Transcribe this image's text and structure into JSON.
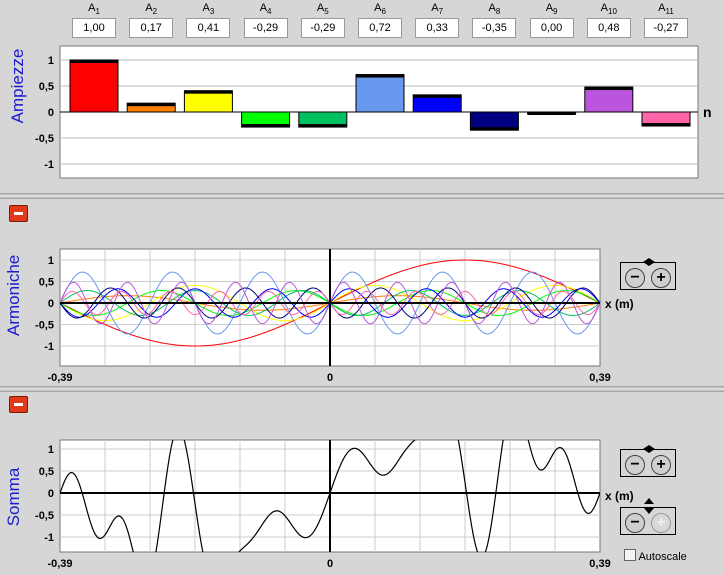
{
  "amplitudes": {
    "items": [
      {
        "label": "A",
        "sub": "1",
        "value": "1,00",
        "v": 1.0,
        "color": "#ff0000"
      },
      {
        "label": "A",
        "sub": "2",
        "value": "0,17",
        "v": 0.17,
        "color": "#ff8000"
      },
      {
        "label": "A",
        "sub": "3",
        "value": "0,41",
        "v": 0.41,
        "color": "#ffff00"
      },
      {
        "label": "A",
        "sub": "4",
        "value": "-0,29",
        "v": -0.29,
        "color": "#00ff00"
      },
      {
        "label": "A",
        "sub": "5",
        "value": "-0,29",
        "v": -0.29,
        "color": "#00c060"
      },
      {
        "label": "A",
        "sub": "6",
        "value": "0,72",
        "v": 0.72,
        "color": "#6699ee"
      },
      {
        "label": "A",
        "sub": "7",
        "value": "0,33",
        "v": 0.33,
        "color": "#0000ff"
      },
      {
        "label": "A",
        "sub": "8",
        "value": "-0,35",
        "v": -0.35,
        "color": "#000080"
      },
      {
        "label": "A",
        "sub": "9",
        "value": "0,00",
        "v": 0.0,
        "color": "#444444"
      },
      {
        "label": "A",
        "sub": "10",
        "value": "0,48",
        "v": 0.48,
        "color": "#bb55dd"
      },
      {
        "label": "A",
        "sub": "11",
        "value": "-0,27",
        "v": -0.27,
        "color": "#ff66aa"
      }
    ],
    "ylabel": "Ampiezze",
    "n_label": "n",
    "yticks": [
      "1",
      "0,5",
      "0",
      "-0,5",
      "-1"
    ]
  },
  "harmonics": {
    "ylabel": "Armoniche",
    "x_axis_label": "x (m)",
    "x_ticks": [
      "-0,39",
      "0",
      "0,39"
    ],
    "yticks": [
      "1",
      "0,5",
      "0",
      "-0,5",
      "-1"
    ]
  },
  "sum": {
    "ylabel": "Somma",
    "x_axis_label": "x (m)",
    "x_ticks": [
      "-0,39",
      "0",
      "0,39"
    ],
    "yticks": [
      "1",
      "0,5",
      "0",
      "-0,5",
      "-1"
    ],
    "autoscale_label": "Autoscale"
  },
  "chart_data": [
    {
      "type": "bar",
      "categories": [
        "A1",
        "A2",
        "A3",
        "A4",
        "A5",
        "A6",
        "A7",
        "A8",
        "A9",
        "A10",
        "A11"
      ],
      "values": [
        1.0,
        0.17,
        0.41,
        -0.29,
        -0.29,
        0.72,
        0.33,
        -0.35,
        0.0,
        0.48,
        -0.27
      ],
      "ylabel": "Ampiezze",
      "xlabel": "n",
      "ylim": [
        -1.3,
        1.2
      ]
    },
    {
      "type": "line",
      "ylabel": "Armoniche",
      "xlabel": "x (m)",
      "xlim": [
        -0.39,
        0.39
      ],
      "ylim": [
        -1.3,
        1.2
      ]
    },
    {
      "type": "line",
      "ylabel": "Somma",
      "xlabel": "x (m)",
      "xlim": [
        -0.39,
        0.39
      ],
      "ylim": [
        -1.3,
        1.2
      ]
    }
  ]
}
